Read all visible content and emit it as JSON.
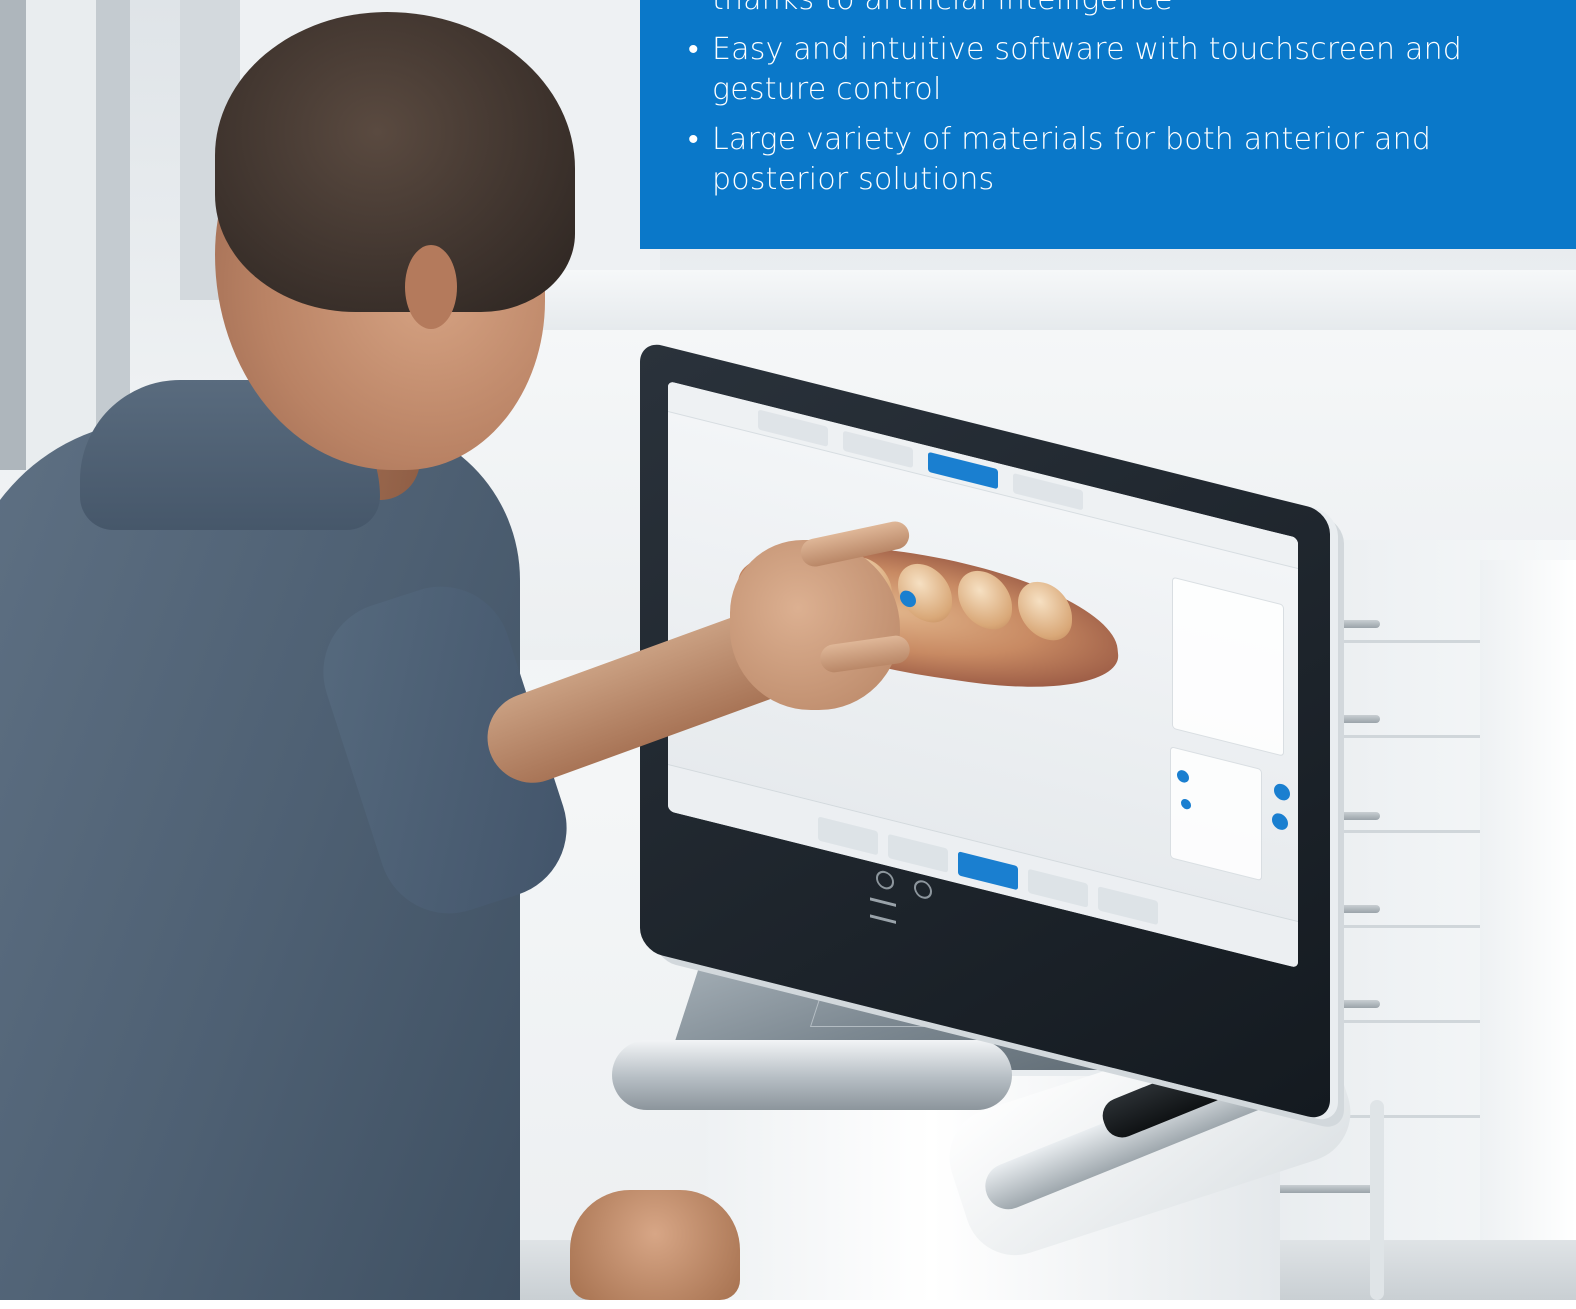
{
  "feature_box": {
    "bullet": "•",
    "items": [
      {
        "text": "thanks to artificial intelligence",
        "continuation": true
      },
      {
        "text": "Easy and intuitive software with touchscreen and gesture control",
        "continuation": false
      },
      {
        "text": "Large variety of materials for both anterior and posterior solutions",
        "continuation": false
      }
    ],
    "background_color": "#0a78c9",
    "text_color": "#ffffff"
  },
  "scene": {
    "screen_accent_color": "#1a7fd0",
    "shirt_color": "#4e6073",
    "chair_color": "#1f4370"
  }
}
